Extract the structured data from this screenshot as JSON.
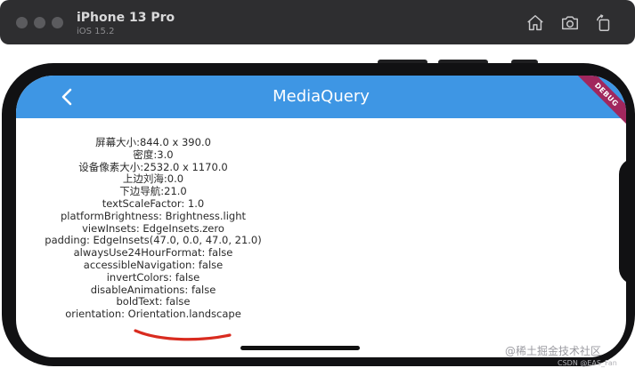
{
  "simulator": {
    "device_name": "iPhone 13 Pro",
    "os_version": "iOS 15.2",
    "toolbar_icons": [
      "home-icon",
      "screenshot-icon",
      "rotate-icon"
    ]
  },
  "app": {
    "title": "MediaQuery",
    "banner": "DEBUG",
    "colors": {
      "appbar": "#3e96e4",
      "banner": "#a1275d",
      "annotation": "#d92b1f"
    },
    "info_lines": [
      "屏幕大小:844.0 x 390.0",
      "密度:3.0",
      "设备像素大小:2532.0 x 1170.0",
      "上边刘海:0.0",
      "下边导航:21.0",
      "textScaleFactor: 1.0",
      "platformBrightness: Brightness.light",
      "viewInsets: EdgeInsets.zero",
      "padding: EdgeInsets(47.0, 0.0, 47.0, 21.0)",
      "alwaysUse24HourFormat: false",
      "accessibleNavigation: false",
      "invertColors: false",
      "disableAnimations: false",
      "boldText: false",
      "orientation: Orientation.landscape"
    ]
  },
  "watermark": "@稀土掘金技术社区",
  "credit": "CSDN @EAS_Fan"
}
